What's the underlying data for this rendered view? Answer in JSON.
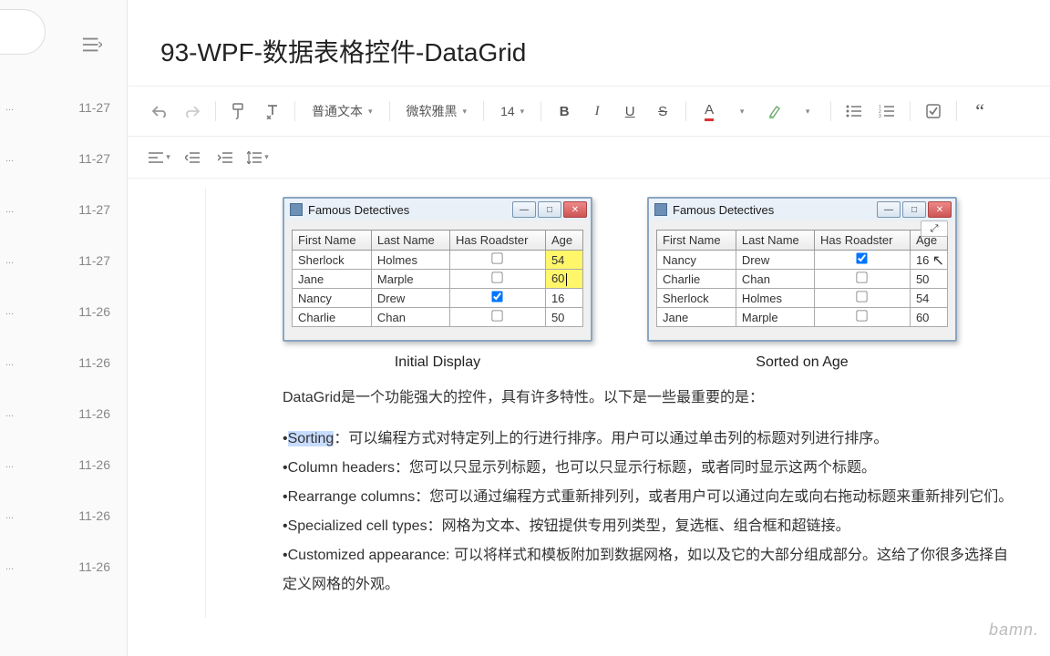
{
  "sidebar": {
    "items": [
      {
        "date": "11-27"
      },
      {
        "date": "11-27"
      },
      {
        "date": "11-27"
      },
      {
        "date": "11-27"
      },
      {
        "date": "11-26"
      },
      {
        "date": "11-26"
      },
      {
        "date": "11-26"
      },
      {
        "date": "11-26"
      },
      {
        "date": "11-26"
      },
      {
        "date": "11-26"
      }
    ]
  },
  "title": "93-WPF-数据表格控件-DataGrid",
  "toolbar": {
    "style_label": "普通文本",
    "font_label": "微软雅黑",
    "size_label": "14"
  },
  "figures": {
    "left": {
      "title": "Famous Detectives",
      "headers": [
        "First Name",
        "Last Name",
        "Has Roadster",
        "Age"
      ],
      "rows": [
        {
          "first": "Sherlock",
          "last": "Holmes",
          "road": false,
          "age": "54",
          "hl": true
        },
        {
          "first": "Jane",
          "last": "Marple",
          "road": false,
          "age": "60",
          "hl": true,
          "caret": true
        },
        {
          "first": "Nancy",
          "last": "Drew",
          "road": true,
          "age": "16"
        },
        {
          "first": "Charlie",
          "last": "Chan",
          "road": false,
          "age": "50"
        }
      ],
      "caption": "Initial Display"
    },
    "right": {
      "title": "Famous Detectives",
      "headers": [
        "First Name",
        "Last Name",
        "Has Roadster",
        "Age"
      ],
      "rows": [
        {
          "first": "Nancy",
          "last": "Drew",
          "road": true,
          "age": "16"
        },
        {
          "first": "Charlie",
          "last": "Chan",
          "road": false,
          "age": "50"
        },
        {
          "first": "Sherlock",
          "last": "Holmes",
          "road": false,
          "age": "54"
        },
        {
          "first": "Jane",
          "last": "Marple",
          "road": false,
          "age": "60"
        }
      ],
      "caption": "Sorted on Age"
    }
  },
  "body": {
    "intro": "DataGrid是一个功能强大的控件，具有许多特性。以下是一些最重要的是：",
    "bullets": [
      {
        "term": "Sorting",
        "sep": "：",
        "text": "可以编程方式对特定列上的行进行排序。用户可以通过单击列的标题对列进行排序。",
        "highlight": true
      },
      {
        "term": "Column headers",
        "sep": "：",
        "text": "您可以只显示列标题，也可以只显示行标题，或者同时显示这两个标题。"
      },
      {
        "term": "Rearrange columns",
        "sep": "：",
        "text": "您可以通过编程方式重新排列列，或者用户可以通过向左或向右拖动标题来重新排列它们。"
      },
      {
        "term": "Specialized cell types",
        "sep": "：",
        "text": "网格为文本、按钮提供专用列类型，复选框、组合框和超链接。"
      },
      {
        "term": "Customized appearance",
        "sep": ": ",
        "text": "可以将样式和模板附加到数据网格，如以及它的大部分组成部分。这给了你很多选择自定义网格的外观。"
      }
    ]
  },
  "watermark": "bamn."
}
